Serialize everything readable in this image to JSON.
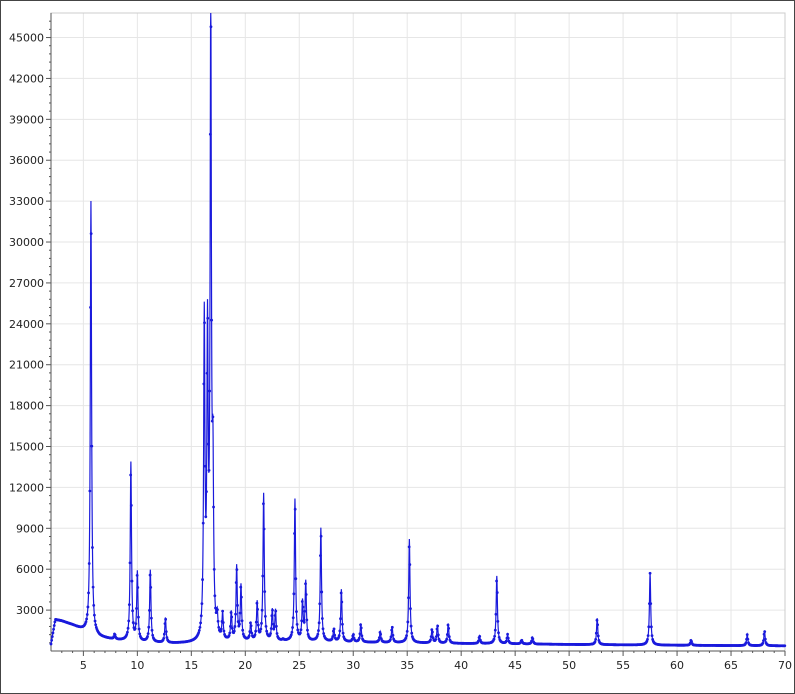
{
  "chart_data": {
    "type": "line",
    "title": "",
    "xlabel": "",
    "ylabel": "",
    "xlim": [
      2,
      70
    ],
    "ylim": [
      0,
      46800
    ],
    "x_ticks": [
      5,
      10,
      15,
      20,
      25,
      30,
      35,
      40,
      45,
      50,
      55,
      60,
      65,
      70
    ],
    "y_ticks": [
      3000,
      6000,
      9000,
      12000,
      15000,
      18000,
      21000,
      24000,
      27000,
      30000,
      33000,
      36000,
      39000,
      42000,
      45000
    ],
    "grid": true,
    "legend": "none",
    "colors": {
      "series": "#1a1adc",
      "grid": "#e6e6e6",
      "axis": "#555555"
    },
    "baseline": [
      [
        2.0,
        500
      ],
      [
        2.4,
        2300
      ],
      [
        3.0,
        2200
      ],
      [
        4.0,
        1900
      ],
      [
        5.0,
        1500
      ],
      [
        6.5,
        1000
      ],
      [
        8.0,
        800
      ],
      [
        10.0,
        650
      ],
      [
        13.0,
        550
      ],
      [
        16.0,
        550
      ],
      [
        20.0,
        700
      ],
      [
        25.0,
        700
      ],
      [
        30.0,
        650
      ],
      [
        35.0,
        600
      ],
      [
        40.0,
        550
      ],
      [
        45.0,
        520
      ],
      [
        50.0,
        480
      ],
      [
        55.0,
        450
      ],
      [
        60.0,
        420
      ],
      [
        65.0,
        400
      ],
      [
        70.0,
        380
      ]
    ],
    "peaks": [
      [
        5.7,
        33000
      ],
      [
        7.9,
        1200
      ],
      [
        8.3,
        700
      ],
      [
        9.4,
        13800
      ],
      [
        10.0,
        5700
      ],
      [
        11.2,
        5900
      ],
      [
        12.6,
        2400
      ],
      [
        15.3,
        500
      ],
      [
        16.2,
        23800
      ],
      [
        16.5,
        22000
      ],
      [
        16.8,
        46500
      ],
      [
        17.0,
        11500
      ],
      [
        17.4,
        2000
      ],
      [
        17.9,
        2500
      ],
      [
        18.7,
        2700
      ],
      [
        19.2,
        6100
      ],
      [
        19.6,
        4700
      ],
      [
        20.5,
        2000
      ],
      [
        21.1,
        3500
      ],
      [
        21.7,
        11500
      ],
      [
        22.5,
        2900
      ],
      [
        22.8,
        2900
      ],
      [
        23.5,
        800
      ],
      [
        24.6,
        11100
      ],
      [
        25.3,
        3500
      ],
      [
        25.6,
        5000
      ],
      [
        27.0,
        9000
      ],
      [
        28.2,
        1600
      ],
      [
        28.9,
        4500
      ],
      [
        30.0,
        1200
      ],
      [
        30.7,
        2000
      ],
      [
        32.5,
        1400
      ],
      [
        33.6,
        1800
      ],
      [
        35.2,
        8200
      ],
      [
        37.3,
        1600
      ],
      [
        37.8,
        1900
      ],
      [
        38.8,
        2000
      ],
      [
        41.7,
        1100
      ],
      [
        43.3,
        5500
      ],
      [
        44.3,
        1200
      ],
      [
        45.6,
        800
      ],
      [
        46.6,
        1000
      ],
      [
        52.6,
        2400
      ],
      [
        57.5,
        5700
      ],
      [
        61.3,
        800
      ],
      [
        66.5,
        1200
      ],
      [
        68.1,
        1500
      ]
    ]
  }
}
